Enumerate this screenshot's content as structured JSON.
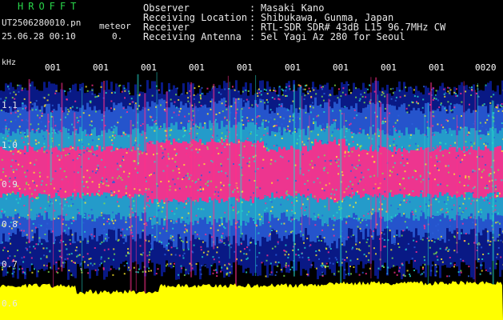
{
  "header": {
    "title": "HROFFT",
    "filename": "UT2506280010.pn",
    "file_tag": "meteor",
    "datetime": "25.06.28 00:10",
    "datetime_extra": "0.",
    "info": [
      {
        "label": "Observer",
        "value": "Masaki Kano"
      },
      {
        "label": "Receiving Location",
        "value": "Shibukawa, Gunma, Japan"
      },
      {
        "label": "Receiver",
        "value": "RTL-SDR SDR# 43dB L15 96.7MHz CW"
      },
      {
        "label": "Receiving Antenna",
        "value": "5el Yagi Az 280 for Seoul"
      }
    ]
  },
  "spectrogram": {
    "y_unit": "kHz",
    "y_ticks": [
      "1.1",
      "1.0",
      "0.9",
      "0.8",
      "0.7",
      "0.6"
    ],
    "time_ticks": [
      "001",
      "001",
      "001",
      "001",
      "001",
      "001",
      "001",
      "001",
      "001",
      "0020"
    ],
    "colors": {
      "background": "#000000",
      "low": "#0a1a8c",
      "mid": "#2a5fd8",
      "high": "#24d6c8",
      "peak": "#ff2d8a",
      "power_trace": "#ffff00"
    }
  }
}
